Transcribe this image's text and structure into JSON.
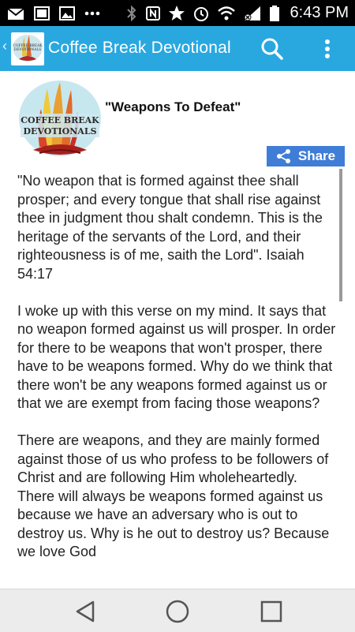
{
  "status_bar": {
    "time": "6:43 PM",
    "left_icons": [
      "mail-icon",
      "gallery-icon",
      "image-icon",
      "more-dots-icon"
    ],
    "right_icons": [
      "bluetooth-icon",
      "nfc-icon",
      "star-icon",
      "alarm-icon",
      "wifi-icon",
      "signal-icon",
      "battery-icon"
    ]
  },
  "app_bar": {
    "title": "Coffee Break Devotional",
    "logo_text_line1": "COFFEE BREAK",
    "logo_text_line2": "DEVOTIONALS"
  },
  "post": {
    "title": "\"Weapons To Defeat\"",
    "share_label": "Share",
    "paragraphs": [
      "\"No weapon that is formed against thee shall prosper; and every tongue that shall rise against thee in judgment thou shalt condemn. This is the heritage of the servants of the Lord, and their righteousness is of me, saith the Lord\".  Isaiah 54:17",
      "I woke up with this verse on my mind.  It says that no weapon formed against us will prosper.  In order for there to be weapons that won't prosper, there have to be weapons formed.  Why do we think that there won't be any weapons formed against us or that we are exempt from facing those weapons?",
      "There are weapons, and they are mainly formed against those of us who profess to be followers of Christ and are following Him wholeheartedly.  There will always be weapons formed against us because we have an adversary who is out to destroy us.  Why is he out to destroy us?  Because we love God"
    ]
  },
  "colors": {
    "app_bar": "#29a8e0",
    "share_button": "#3f7dd6",
    "status_bar": "#000000"
  }
}
